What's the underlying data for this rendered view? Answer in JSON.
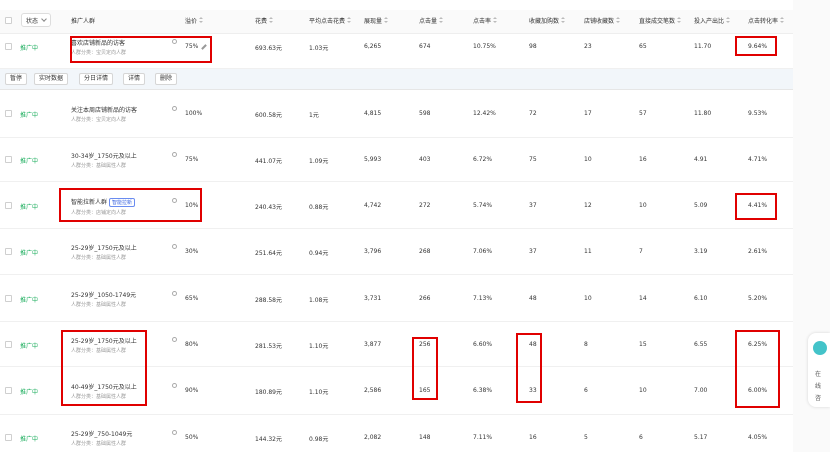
{
  "header": {
    "status": "状态",
    "name": "推广人群",
    "bid": "溢价",
    "spend": "花费",
    "avg_cpc": "平均点击花费",
    "impressions": "展现量",
    "clicks": "点击量",
    "ctr": "点击率",
    "collect_cart": "收藏加购数",
    "collect_shop": "店铺收藏数",
    "deal_num": "直接成交笔数",
    "roi": "投入产出比",
    "cvr": "点击转化率"
  },
  "actionbar": {
    "pause": "暂停",
    "realtime": "实时数据",
    "report": "分日详情",
    "detail": "详情",
    "delete": "删除"
  },
  "rows": [
    {
      "status": "推广中",
      "name": "喜欢店铺新品的访客",
      "sub": "人群分类：宝贝定向人群",
      "bid": "75%",
      "spend": "693.63元",
      "cpc": "1.03元",
      "impr": "6,265",
      "clicks": "674",
      "ctr": "10.75%",
      "fav": "98",
      "shopfav": "23",
      "deal": "65",
      "roi": "11.70",
      "cvr": "9.64%"
    },
    {
      "status": "推广中",
      "name": "关注本周店铺新品的访客",
      "sub": "人群分类：宝贝定向人群",
      "bid": "100%",
      "spend": "600.58元",
      "cpc": "1元",
      "impr": "4,815",
      "clicks": "598",
      "ctr": "12.42%",
      "fav": "72",
      "shopfav": "17",
      "deal": "57",
      "roi": "11.80",
      "cvr": "9.53%"
    },
    {
      "status": "推广中",
      "name": "30-34岁_1750元及以上",
      "sub": "人群分类：基础属性人群",
      "bid": "75%",
      "spend": "441.07元",
      "cpc": "1.09元",
      "impr": "5,993",
      "clicks": "403",
      "ctr": "6.72%",
      "fav": "75",
      "shopfav": "10",
      "deal": "16",
      "roi": "4.91",
      "cvr": "4.71%"
    },
    {
      "status": "推广中",
      "name": "智能拉新人群",
      "badge": "智能拉新",
      "sub": "人群分类：店铺定向人群",
      "bid": "10%",
      "spend": "240.43元",
      "cpc": "0.88元",
      "impr": "4,742",
      "clicks": "272",
      "ctr": "5.74%",
      "fav": "37",
      "shopfav": "12",
      "deal": "10",
      "roi": "5.09",
      "cvr": "4.41%"
    },
    {
      "status": "推广中",
      "name": "25-29岁_1750元及以上",
      "sub": "人群分类：基础属性人群",
      "bid": "30%",
      "spend": "251.64元",
      "cpc": "0.94元",
      "impr": "3,796",
      "clicks": "268",
      "ctr": "7.06%",
      "fav": "37",
      "shopfav": "11",
      "deal": "7",
      "roi": "3.19",
      "cvr": "2.61%"
    },
    {
      "status": "推广中",
      "name": "25-29岁_1050-1749元",
      "sub": "人群分类：基础属性人群",
      "bid": "65%",
      "spend": "288.58元",
      "cpc": "1.08元",
      "impr": "3,731",
      "clicks": "266",
      "ctr": "7.13%",
      "fav": "48",
      "shopfav": "10",
      "deal": "14",
      "roi": "6.10",
      "cvr": "5.20%"
    },
    {
      "status": "推广中",
      "name": "25-29岁_1750元及以上",
      "sub": "人群分类：基础属性人群",
      "bid": "80%",
      "spend": "281.53元",
      "cpc": "1.10元",
      "impr": "3,877",
      "clicks": "256",
      "ctr": "6.60%",
      "fav": "48",
      "shopfav": "8",
      "deal": "15",
      "roi": "6.55",
      "cvr": "6.25%"
    },
    {
      "status": "推广中",
      "name": "40-49岁_1750元及以上",
      "sub": "人群分类：基础属性人群",
      "bid": "90%",
      "spend": "180.89元",
      "cpc": "1.10元",
      "impr": "2,586",
      "clicks": "165",
      "ctr": "6.38%",
      "fav": "33",
      "shopfav": "6",
      "deal": "10",
      "roi": "7.00",
      "cvr": "6.00%"
    },
    {
      "status": "推广中",
      "name": "25-29岁_750-1049元",
      "sub": "人群分类：基础属性人群",
      "bid": "50%",
      "spend": "144.32元",
      "cpc": "0.98元",
      "impr": "2,082",
      "clicks": "148",
      "ctr": "7.11%",
      "fav": "16",
      "shopfav": "5",
      "deal": "6",
      "roi": "5.17",
      "cvr": "4.05%"
    }
  ],
  "side": {
    "line1": "在",
    "line2": "线",
    "line3": "咨"
  },
  "colors": {
    "status_green": "#1aad5c",
    "highlight_red": "#e00000",
    "badge_blue": "#3a64e0"
  }
}
